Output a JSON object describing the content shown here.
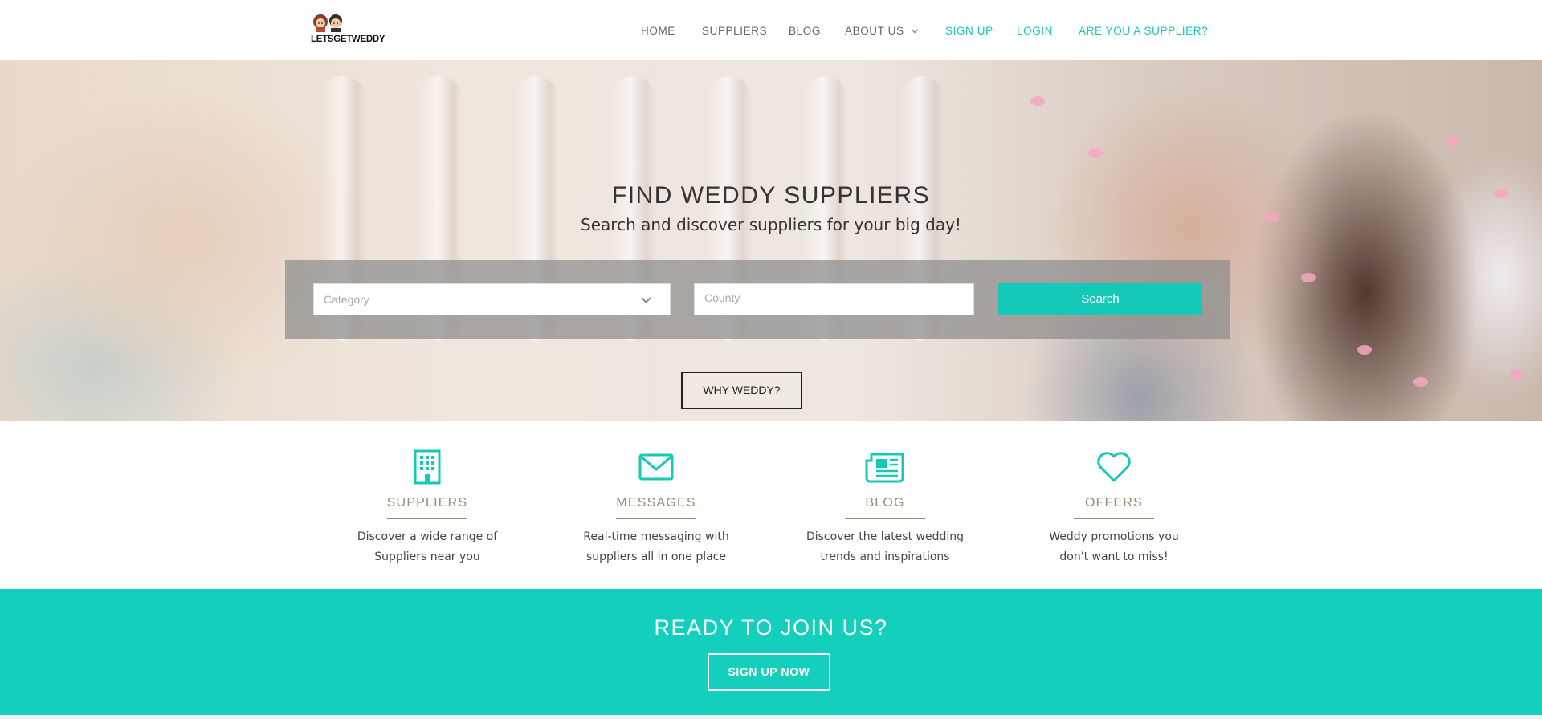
{
  "brand": {
    "logo_text": "LETSGETWEDDY"
  },
  "nav": {
    "items": [
      {
        "label": "HOME"
      },
      {
        "label": "SUPPLIERS"
      },
      {
        "label": "BLOG"
      },
      {
        "label": "ABOUT US"
      },
      {
        "label": "SIGN UP"
      },
      {
        "label": "LOGIN"
      },
      {
        "label": "ARE YOU A SUPPLIER?"
      }
    ]
  },
  "hero": {
    "title": "FIND WEDDY SUPPLIERS",
    "subtitle": "Search and discover suppliers for your big day!",
    "search": {
      "category_placeholder": "Category",
      "county_placeholder": "County",
      "button_label": "Search"
    },
    "why_button_label": "WHY WEDDY?"
  },
  "features": [
    {
      "icon": "building-icon",
      "title": "SUPPLIERS",
      "desc": "Discover a wide range of Suppliers near you"
    },
    {
      "icon": "envelope-icon",
      "title": "MESSAGES",
      "desc": "Real-time messaging with suppliers all in one place"
    },
    {
      "icon": "newspaper-icon",
      "title": "BLOG",
      "desc": "Discover the latest wedding trends and inspirations"
    },
    {
      "icon": "heart-icon",
      "title": "OFFERS",
      "desc": "Weddy promotions you don't want to miss!"
    }
  ],
  "cta": {
    "title": "READY TO JOIN US?",
    "button_label": "SIGN UP NOW"
  },
  "colors": {
    "accent": "#14c9b8",
    "feature_title": "#9a8a72",
    "nav_text": "#666666"
  }
}
